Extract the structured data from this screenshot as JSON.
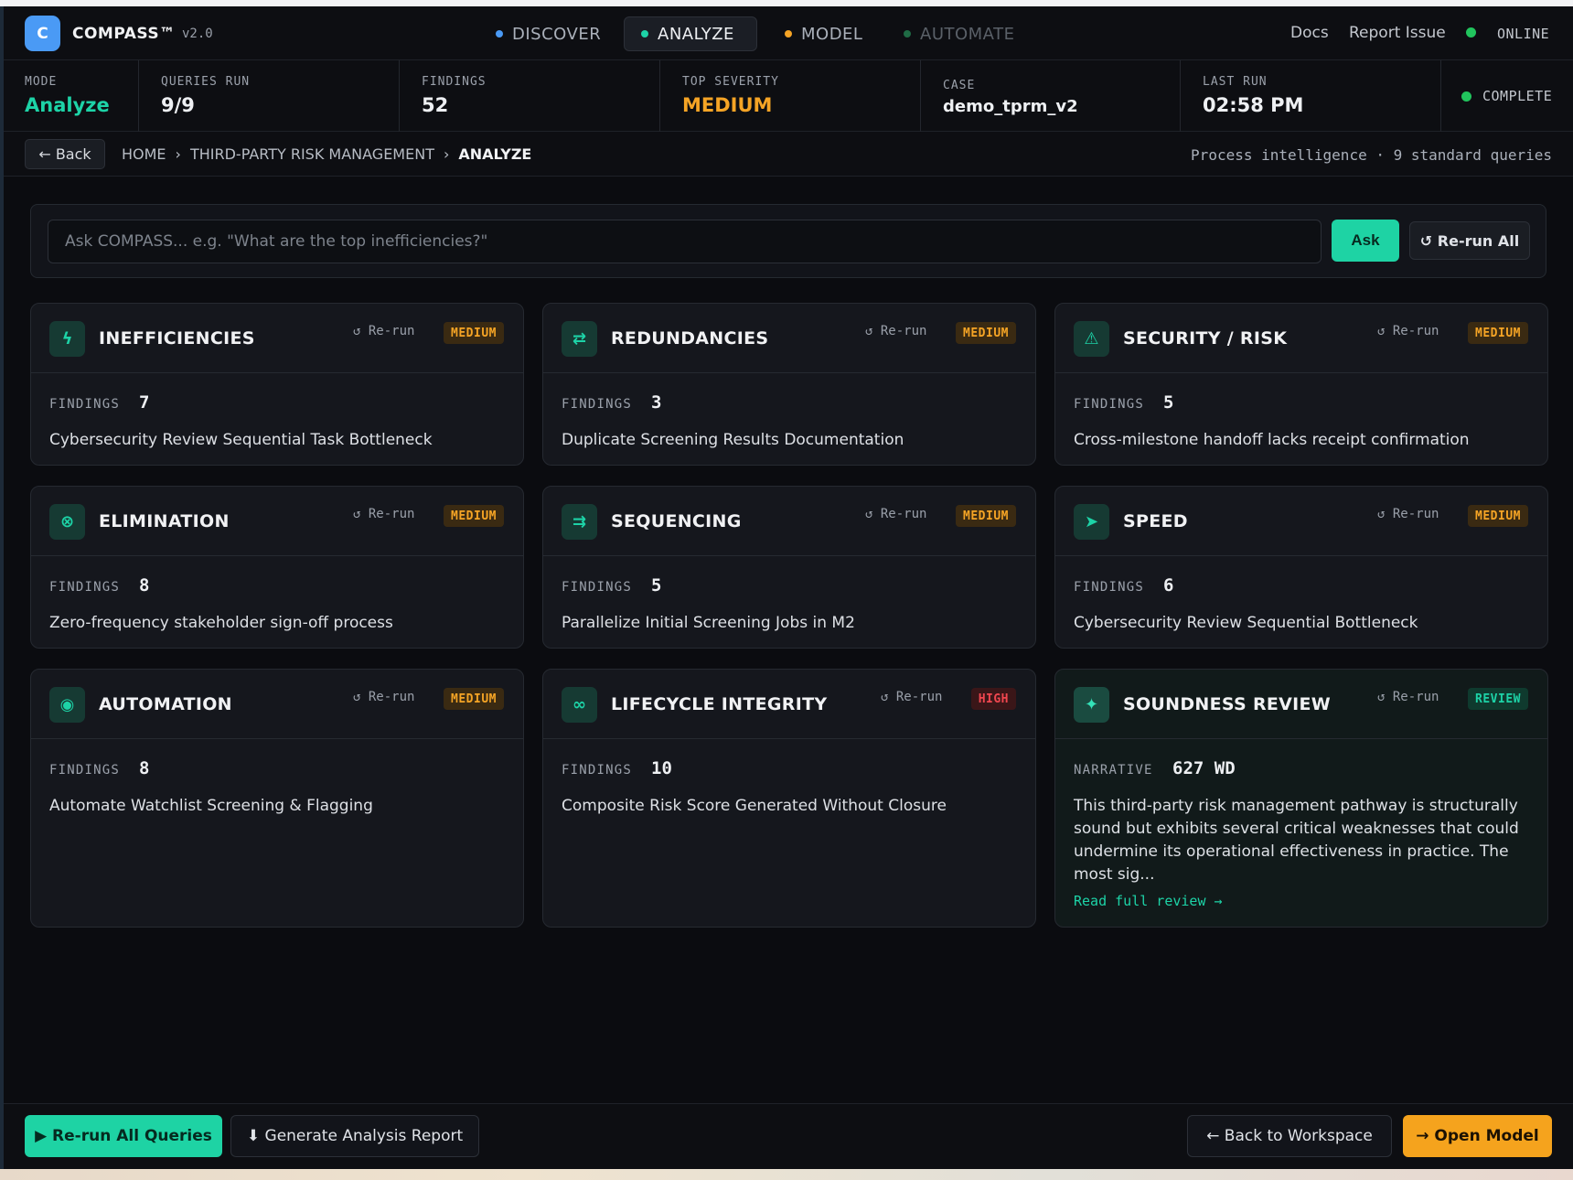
{
  "app": {
    "logo_letter": "C",
    "name": "COMPASS™",
    "version": "v2.0"
  },
  "nav": {
    "tabs": [
      {
        "label": "DISCOVER",
        "dot_color": "#4a9af5"
      },
      {
        "label": "ANALYZE",
        "dot_color": "#1dd3a7",
        "active": true
      },
      {
        "label": "MODEL",
        "dot_color": "#f5a425"
      },
      {
        "label": "AUTOMATE",
        "dot_color": "#1f6b45",
        "disabled": true
      }
    ],
    "docs": "Docs",
    "report_issue": "Report Issue",
    "status": "ONLINE"
  },
  "stats": {
    "mode": {
      "label": "MODE",
      "value": "Analyze"
    },
    "queries": {
      "label": "QUERIES RUN",
      "value": "9/9"
    },
    "findings": {
      "label": "FINDINGS",
      "value": "52"
    },
    "severity": {
      "label": "TOP SEVERITY",
      "value": "MEDIUM"
    },
    "case": {
      "label": "CASE",
      "value": "demo_tprm_v2"
    },
    "last_run": {
      "label": "LAST RUN",
      "value": "02:58 PM"
    },
    "run_status": "COMPLETE"
  },
  "breadcrumb": {
    "back": "← Back",
    "items": [
      "HOME",
      "THIRD-PARTY RISK MANAGEMENT",
      "ANALYZE"
    ],
    "separator": "›",
    "info": "Process intelligence · 9 standard queries"
  },
  "ask": {
    "placeholder": "Ask COMPASS... e.g. \"What are the top inefficiencies?\"",
    "value": "",
    "ask_label": "Ask",
    "rerun_all_label": "↺ Re-run All"
  },
  "cards": [
    {
      "title": "INEFFICIENCIES",
      "icon": "lightning-icon",
      "glyph": "ϟ",
      "rerun": "↺ Re-run",
      "badge": "MEDIUM",
      "metric_label": "FINDINGS",
      "metric_value": "7",
      "text": "Cybersecurity Review Sequential Task Bottleneck"
    },
    {
      "title": "REDUNDANCIES",
      "icon": "swap-arrows-icon",
      "glyph": "⇄",
      "rerun": "↺ Re-run",
      "badge": "MEDIUM",
      "metric_label": "FINDINGS",
      "metric_value": "3",
      "text": "Duplicate Screening Results Documentation"
    },
    {
      "title": "SECURITY / RISK",
      "icon": "warning-triangle-icon",
      "glyph": "⚠",
      "rerun": "↺ Re-run",
      "badge": "MEDIUM",
      "metric_label": "FINDINGS",
      "metric_value": "5",
      "text": "Cross-milestone handoff lacks receipt confirmation"
    },
    {
      "title": "ELIMINATION",
      "icon": "circle-x-icon",
      "glyph": "⊗",
      "rerun": "↺ Re-run",
      "badge": "MEDIUM",
      "metric_label": "FINDINGS",
      "metric_value": "8",
      "text": "Zero-frequency stakeholder sign-off process"
    },
    {
      "title": "SEQUENCING",
      "icon": "parallel-arrows-icon",
      "glyph": "⇉",
      "rerun": "↺ Re-run",
      "badge": "MEDIUM",
      "metric_label": "FINDINGS",
      "metric_value": "5",
      "text": "Parallelize Initial Screening Jobs in M2"
    },
    {
      "title": "SPEED",
      "icon": "play-arrow-icon",
      "glyph": "➤",
      "rerun": "↺ Re-run",
      "badge": "MEDIUM",
      "metric_label": "FINDINGS",
      "metric_value": "6",
      "text": "Cybersecurity Review Sequential Bottleneck"
    },
    {
      "title": "AUTOMATION",
      "icon": "target-icon",
      "glyph": "◉",
      "rerun": "↺ Re-run",
      "badge": "MEDIUM",
      "metric_label": "FINDINGS",
      "metric_value": "8",
      "text": "Automate Watchlist Screening & Flagging"
    },
    {
      "title": "LIFECYCLE INTEGRITY",
      "icon": "infinity-icon",
      "glyph": "∞",
      "rerun": "↺ Re-run",
      "badge": "HIGH",
      "metric_label": "FINDINGS",
      "metric_value": "10",
      "text": "Composite Risk Score Generated Without Closure"
    },
    {
      "title": "SOUNDNESS REVIEW",
      "icon": "sparkle-icon",
      "glyph": "✦",
      "rerun": "↺ Re-run",
      "badge": "REVIEW",
      "metric_label": "NARRATIVE",
      "metric_value": "627 WD",
      "text": "This third-party risk management pathway is structurally sound but exhibits several critical weaknesses that could undermine its operational effectiveness in practice. The most sig...",
      "link": "Read full review →"
    }
  ],
  "footer": {
    "rerun_queries": "▶ Re-run All Queries",
    "generate_report": "⬇ Generate Analysis Report",
    "back_workspace": "← Back to Workspace",
    "open_model": "→ Open Model"
  },
  "colors": {
    "accent": "#1dd3a7",
    "warning": "#f5a425",
    "danger": "#f0464f",
    "logo": "#4a9af5"
  }
}
